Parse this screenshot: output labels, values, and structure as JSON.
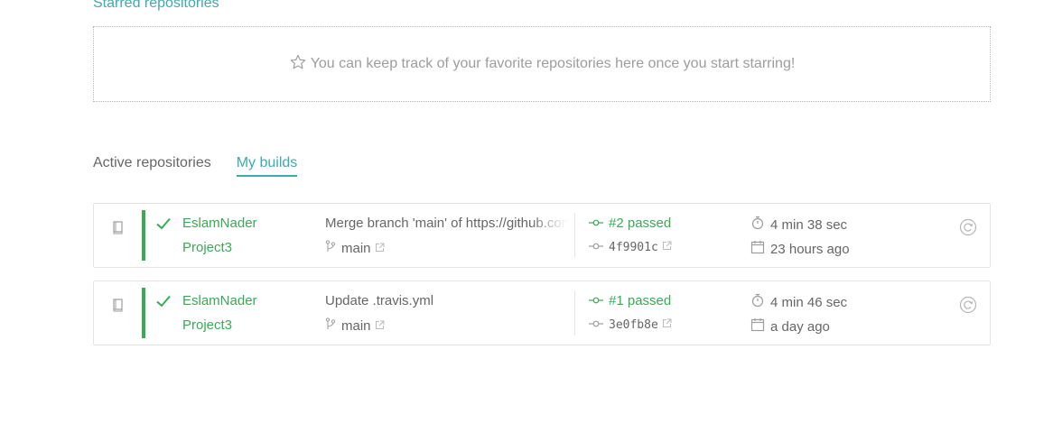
{
  "starred": {
    "heading": "Starred repositories",
    "empty_message": "You can keep track of your favorite repositories here once you start starring!"
  },
  "tabs": [
    {
      "label": "Active repositories",
      "active": false
    },
    {
      "label": "My builds",
      "active": true
    }
  ],
  "builds": [
    {
      "owner": "EslamNader",
      "repo": "Project3",
      "message": "Merge branch 'main' of https://github.com/EslamNader",
      "branch": "main",
      "status": "#2 passed",
      "commit": "4f9901c",
      "duration": "4 min 38 sec",
      "finished": "23 hours ago"
    },
    {
      "owner": "EslamNader",
      "repo": "Project3",
      "message": "Update .travis.yml",
      "branch": "main",
      "status": "#1 passed",
      "commit": "3e0fb8e",
      "duration": "4 min 46 sec",
      "finished": "a day ago"
    }
  ],
  "colors": {
    "passed": "#39aa56",
    "accent": "#3eaaaf",
    "text": "#666666",
    "muted": "#9d9d9d"
  }
}
